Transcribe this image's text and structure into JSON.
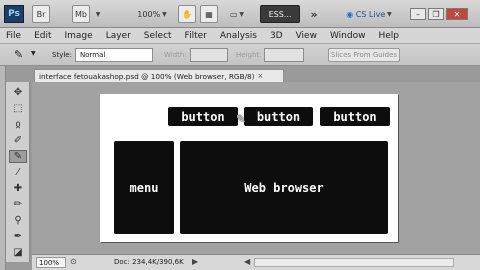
{
  "appbar": {
    "logo": "Ps",
    "mode_label": "ESS...",
    "zoom": "100%",
    "cs_live": "CS Live"
  },
  "menu": [
    "File",
    "Edit",
    "Image",
    "Layer",
    "Select",
    "Filter",
    "Analysis",
    "3D",
    "View",
    "Window",
    "Help"
  ],
  "options": {
    "style_label": "Style:",
    "style_value": "Normal",
    "width_label": "Width:",
    "height_label": "Height:",
    "refine_button": "Slices From Guides"
  },
  "document": {
    "tab_title": "interface fetouakashop.psd @ 100% (Web browser, RGB/8)",
    "tab_close": "×",
    "buttons": [
      "button",
      "button",
      "button"
    ],
    "menu_block": "menu",
    "browser_block": "Web browser"
  },
  "status": {
    "zoom": "100%",
    "doc_info": "Doc: 234,4K/390,6K"
  },
  "colors": {
    "canvas_bg": "#a2a2a2",
    "block_fill": "#0d0d0d",
    "block_text": "#ffffff"
  }
}
